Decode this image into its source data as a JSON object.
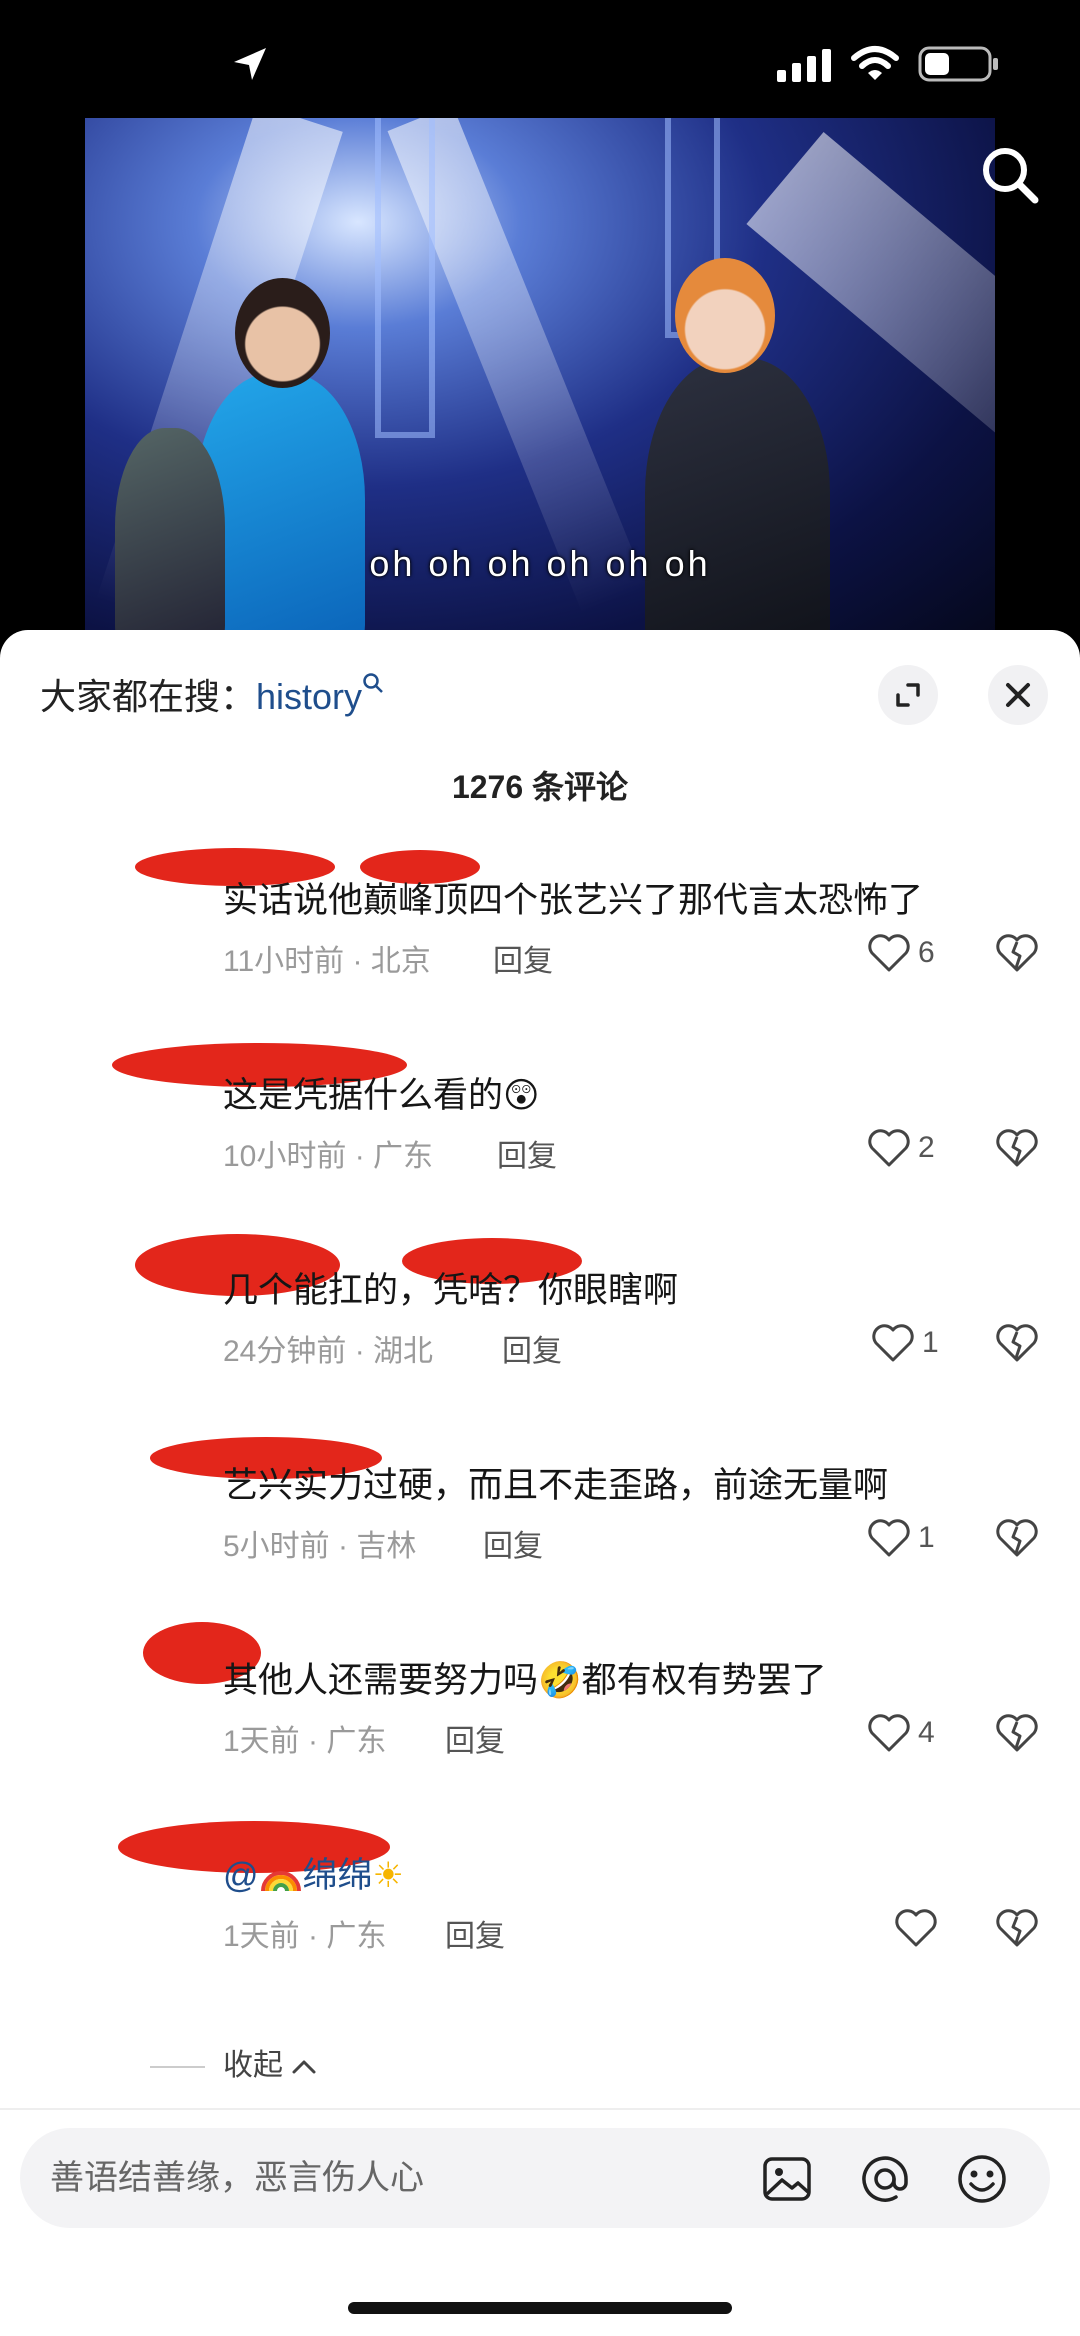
{
  "video": {
    "subtitle": "oh oh oh oh oh oh"
  },
  "sheet": {
    "search_prefix": "大家都在搜：",
    "search_keyword": "history",
    "comment_count": "1276 条评论",
    "collapse_label": "收起",
    "input_placeholder": "善语结善缘，恶言伤人心"
  },
  "comments": [
    {
      "text": "实话说他巅峰顶四个张艺兴了那代言太恐怖了",
      "meta": "11小时前 · 北京",
      "reply": "回复",
      "likes": "6"
    },
    {
      "text": "这是凭据什么看的",
      "emoji": "😲",
      "meta": "10小时前 · 广东",
      "reply": "回复",
      "likes": "2"
    },
    {
      "text": "几个能扛的，凭啥？你眼瞎啊",
      "meta": "24分钟前 · 湖北",
      "reply": "回复",
      "likes": "1"
    },
    {
      "text": "艺兴实力过硬，而且不走歪路，前途无量啊",
      "meta": "5小时前 · 吉林",
      "reply": "回复",
      "likes": "1"
    },
    {
      "text_a": "其他人还需要努力吗",
      "emoji": "🤣",
      "text_b": "都有权有势罢了",
      "meta": "1天前 · 广东",
      "reply": "回复",
      "likes": "4"
    },
    {
      "mention": "@",
      "mention_name": "绵绵",
      "emoji": "☀",
      "meta": "1天前 · 广东",
      "reply": "回复",
      "likes": ""
    }
  ],
  "colors": {
    "accent": "#1f4e8c",
    "redaction": "#e3261b"
  },
  "icons": [
    "location-arrow-icon",
    "signal-icon",
    "wifi-icon",
    "battery-icon",
    "search-icon",
    "expand-icon",
    "close-icon",
    "heart-icon",
    "broken-heart-icon",
    "image-icon",
    "at-icon",
    "emoji-icon"
  ]
}
